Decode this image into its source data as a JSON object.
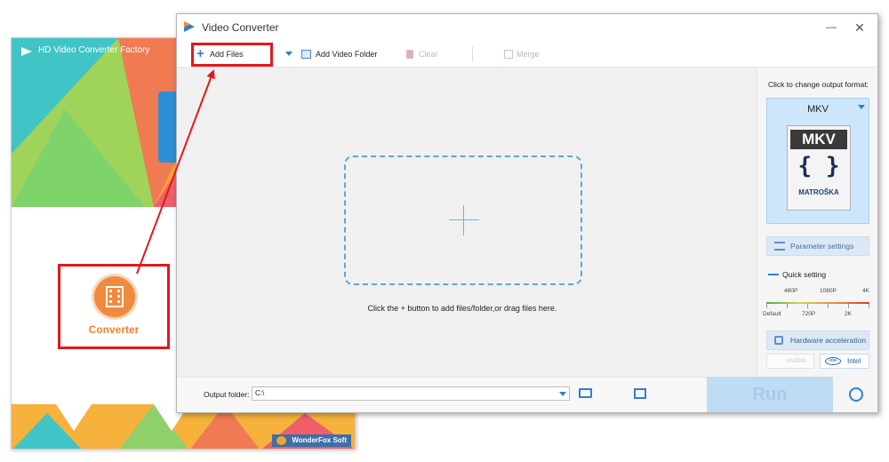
{
  "launcher": {
    "title": "HD Video Converter Factory",
    "converter_label": "Converter",
    "footer": "WonderFox Soft"
  },
  "window": {
    "title": "Video Converter",
    "minimize": "—",
    "close": "✕"
  },
  "toolbar": {
    "add_files": "Add Files",
    "add_video_folder": "Add Video Folder",
    "clear": "Clear",
    "merge": "Merge"
  },
  "workspace": {
    "hint": "Click the + button to add files/folder,or drag files here."
  },
  "sidebar": {
    "format_hint": "Click to change output format:",
    "format_name": "MKV",
    "format_icon_text": "MKV",
    "format_icon_brace": "{ }",
    "format_icon_brand": "MATROŠKA",
    "parameter_settings": "Parameter settings",
    "quick_setting": "Quick setting",
    "quality_ticks_top": [
      "480P",
      "1080P",
      "4K"
    ],
    "quality_ticks_bottom": [
      "Default",
      "720P",
      "2K"
    ],
    "hardware_acceleration": "Hardware acceleration",
    "nvidia": "NVIDIA",
    "intel": "Intel",
    "intel_icon": "intel"
  },
  "bottom": {
    "output_folder_label": "Output folder:",
    "output_folder_value": "C:\\",
    "run": "Run"
  },
  "colors": {
    "accent": "#2f7fd3",
    "highlight_red": "#e5171a",
    "converter_orange": "#ef8233"
  },
  "icons": {
    "add": "plus-icon",
    "folder": "folder-icon",
    "trash": "trash-icon",
    "merge": "merge-icon",
    "alarm": "alarm-clock-icon"
  }
}
